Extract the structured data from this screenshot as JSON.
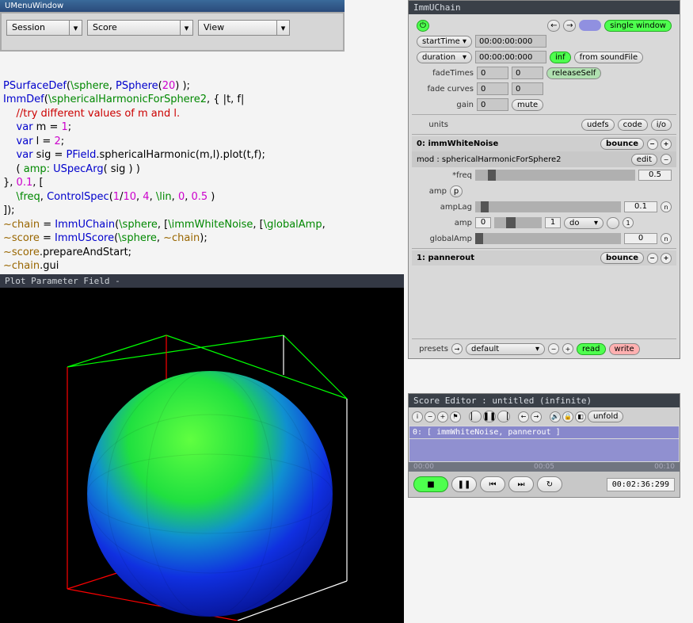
{
  "menuWindow": {
    "title": "UMenuWindow",
    "session": "Session",
    "score": "Score",
    "view": "View"
  },
  "code": {
    "line1a": "PSurfaceDef",
    "line1b": "(",
    "line1c": "\\sphere",
    "line1d": ", ",
    "line1e": "PSphere",
    "line1f": "(",
    "line1g": "20",
    "line1h": ") );",
    "line2a": "ImmDef",
    "line2b": "(",
    "line2c": "\\sphericalHarmonicForSphere2",
    "line2d": ", { |t, f|",
    "line3": "    //try different values of m and l.",
    "line4a": "    ",
    "line4b": "var",
    "line4c": " m = ",
    "line4d": "1",
    "line4e": ";",
    "line5a": "    ",
    "line5b": "var",
    "line5c": " l = ",
    "line5d": "2",
    "line5e": ";",
    "line6a": "    ",
    "line6b": "var",
    "line6c": " sig = ",
    "line6d": "PField",
    "line6e": ".sphericalHarmonic(m,l).plot(t,f);",
    "line7a": "    ( ",
    "line7b": "amp:",
    "line7c": " ",
    "line7d": "USpecArg",
    "line7e": "( sig ) )",
    "line8a": "}, ",
    "line8b": "0.1",
    "line8c": ", [",
    "line9a": "    ",
    "line9b": "\\freq",
    "line9c": ", ",
    "line9d": "ControlSpec",
    "line9e": "(",
    "line9f": "1",
    "line9g": "/",
    "line9h": "10",
    "line9i": ", ",
    "line9j": "4",
    "line9k": ", ",
    "line9l": "\\lin",
    "line9m": ", ",
    "line9n": "0",
    "line9o": ", ",
    "line9p": "0.5",
    "line9q": " )",
    "line10": "]);",
    "line11a": "~chain",
    "line11b": " = ",
    "line11c": "ImmUChain",
    "line11d": "(",
    "line11e": "\\sphere",
    "line11f": ", [",
    "line11g": "\\immWhiteNoise",
    "line11h": ", [",
    "line11i": "\\globalAmp",
    "line11j": ",",
    "line12a": "~score",
    "line12b": " = ",
    "line12c": "ImmUScore",
    "line12d": "(",
    "line12e": "\\sphere",
    "line12f": ", ",
    "line12g": "~chain",
    "line12h": ");",
    "line13a": "~score",
    "line13b": ".prepareAndStart;",
    "line14a": "~chain",
    "line14b": ".gui"
  },
  "plot": {
    "title": "Plot Parameter Field -"
  },
  "chain": {
    "title": "ImmUChain",
    "singleWindow": "single window",
    "startTime": {
      "label": "startTime",
      "value": "00:00:00:000"
    },
    "duration": {
      "label": "duration",
      "value": "00:00:00:000",
      "inf": "inf",
      "fromSF": "from soundFile"
    },
    "fadeTimes": {
      "label": "fadeTimes",
      "a": "0",
      "b": "0",
      "release": "releaseSelf"
    },
    "fadeCurves": {
      "label": "fade curves",
      "a": "0",
      "b": "0"
    },
    "gain": {
      "label": "gain",
      "value": "0",
      "mute": "mute"
    },
    "unitsLabel": "units",
    "udefs": "udefs",
    "codeBtn": "code",
    "io": "i/o",
    "unit0": {
      "title": "0: immWhiteNoise",
      "bounce": "bounce"
    },
    "mod": {
      "label": "mod : sphericalHarmonicForSphere2",
      "edit": "edit"
    },
    "freq": {
      "label": "*freq",
      "value": "0.5"
    },
    "ampP": {
      "label": "amp",
      "p": "p"
    },
    "ampLag": {
      "label": "ampLag",
      "value": "0.1",
      "n": "n"
    },
    "amp": {
      "label": "amp",
      "lo": "0",
      "hi": "1",
      "do": "do",
      "one": "1"
    },
    "globalAmp": {
      "label": "globalAmp",
      "value": "0",
      "n": "n"
    },
    "unit1": {
      "title": "1: pannerout",
      "bounce": "bounce"
    },
    "presets": {
      "label": "presets",
      "default": "default",
      "read": "read",
      "write": "write"
    }
  },
  "score": {
    "title": "Score Editor : untitled (infinite)",
    "unfold": "unfold",
    "track0": "0: [ immWhiteNoise, pannerout ]",
    "t0": "00:00",
    "t5": "00:05",
    "t10": "00:10",
    "time": "00:02:36:299"
  }
}
